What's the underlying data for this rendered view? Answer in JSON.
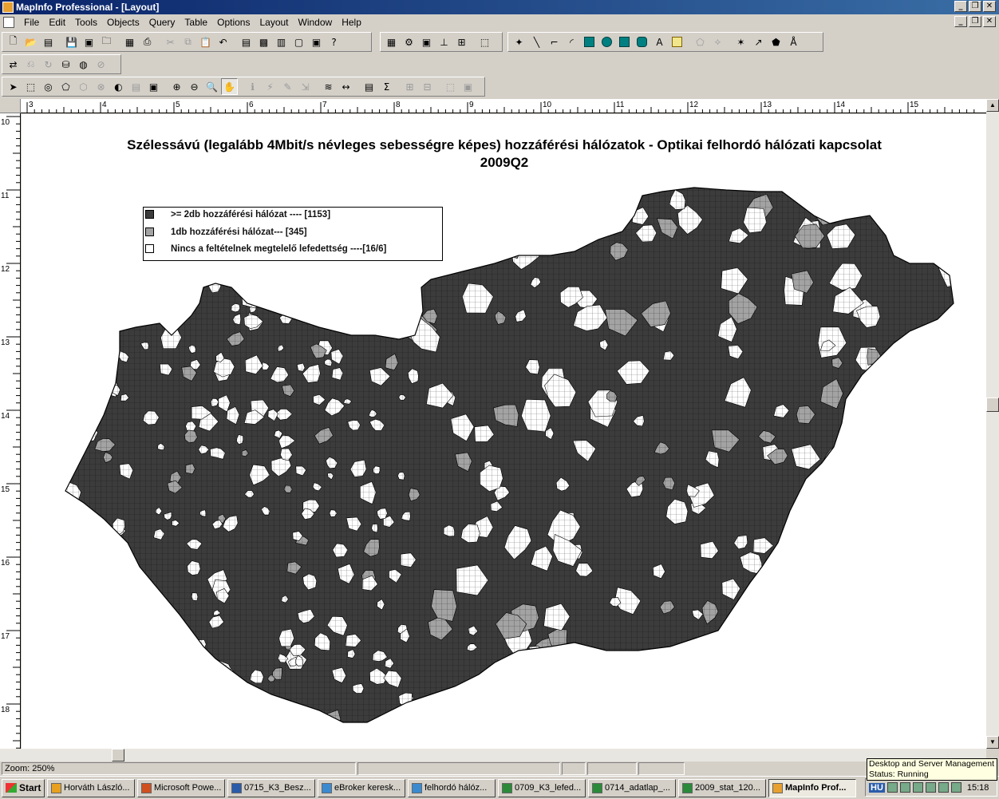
{
  "window": {
    "title": "MapInfo Professional - [Layout]",
    "controls": [
      "_",
      "❐",
      "✕"
    ]
  },
  "menu": [
    "File",
    "Edit",
    "Tools",
    "Objects",
    "Query",
    "Table",
    "Options",
    "Layout",
    "Window",
    "Help"
  ],
  "rulers": {
    "horizontal": [
      "3",
      "4",
      "5",
      "6",
      "7",
      "8",
      "9",
      "10",
      "11",
      "12",
      "13",
      "14",
      "15"
    ],
    "vertical": [
      "10",
      "11",
      "12",
      "13",
      "14",
      "15",
      "16",
      "17",
      "18"
    ]
  },
  "map": {
    "title_line1": "Szélessávú (legalább 4Mbit/s névleges sebességre képes) hozzáférési hálózatok - Optikai felhordó hálózati kapcsolat",
    "title_line2": "2009Q2",
    "legend": [
      {
        "label": ">= 2db hozzáférési hálózat ---- [1153]",
        "color": "#3c3c3c"
      },
      {
        "label": "1db hozzáférési hálózat--- [345]",
        "color": "#a3a3a3"
      },
      {
        "label": "Nincs a feltételnek megtelelő lefedettség ----[16/6]",
        "color": "#ffffff"
      }
    ]
  },
  "status": {
    "zoom": "Zoom: 250%"
  },
  "tooltip": {
    "line1": "Desktop and Server Management",
    "line2": "Status: Running"
  },
  "taskbar": {
    "start": "Start",
    "tasks": [
      "Horváth László...",
      "Microsoft Powe...",
      "0715_K3_Besz...",
      "eBroker keresk...",
      "felhordó hálóz...",
      "0709_K3_lefed...",
      "0714_adatlap_...",
      "2009_stat_120...",
      "MapInfo Prof..."
    ],
    "lang": "HU",
    "clock": "15:18"
  }
}
